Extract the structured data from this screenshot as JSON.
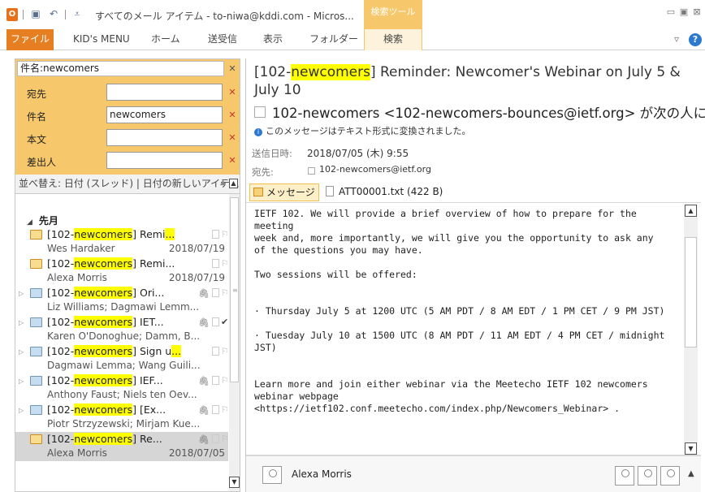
{
  "window": {
    "app_icon_text": "O",
    "title": "すべてのメール アイテム - to-niwa@kddi.com - Micros...",
    "context_tab_header": "検索ツール"
  },
  "ribbon": {
    "tabs": [
      "ファイル",
      "KID's MENU",
      "ホーム",
      "送受信",
      "表示",
      "フォルダー",
      "検索"
    ],
    "accent_color": "#e57f21",
    "context_color": "#f7c86b"
  },
  "search": {
    "main_query": "件名:newcomers",
    "fields": [
      {
        "label": "宛先",
        "value": ""
      },
      {
        "label": "件名",
        "value": "newcomers"
      },
      {
        "label": "本文",
        "value": ""
      },
      {
        "label": "差出人",
        "value": ""
      }
    ]
  },
  "list": {
    "sort_label": "並べ替え: 日付 (スレッド) | 日付の新しいアイテム",
    "group_label": "先月",
    "highlight_term": "newcomers",
    "items": [
      {
        "prefix": "[102-",
        "hl": "newcomers",
        "suffix": "] Remi",
        "tail_hl": "...",
        "from": "Wes Hardaker",
        "date": "2018/07/19",
        "conv": false,
        "attach": false,
        "flag": "flag"
      },
      {
        "prefix": "[102-",
        "hl": "newcomers",
        "suffix": "] Remi...",
        "tail_hl": "",
        "from": "Alexa Morris",
        "date": "2018/07/19",
        "conv": false,
        "attach": false,
        "flag": "flag"
      },
      {
        "prefix": "[102-",
        "hl": "newcomers",
        "suffix": "] Ori...",
        "tail_hl": "",
        "from": "Liz Williams;  Dagmawi Lemm...",
        "date": "",
        "conv": true,
        "attach": true,
        "flag": "flag"
      },
      {
        "prefix": "[102-",
        "hl": "newcomers",
        "suffix": "] IET...",
        "tail_hl": "",
        "from": "Karen O'Donoghue;  Damm, B...",
        "date": "",
        "conv": true,
        "attach": true,
        "flag": "check"
      },
      {
        "prefix": "[102-",
        "hl": "newcomers",
        "suffix": "] Sign u",
        "tail_hl": "...",
        "from": "Dagmawi Lemma;  Wang Guili...",
        "date": "",
        "conv": true,
        "attach": false,
        "flag": "flag"
      },
      {
        "prefix": "[102-",
        "hl": "newcomers",
        "suffix": "] IEF...",
        "tail_hl": "",
        "from": "Anthony Faust;  Niels ten Oev...",
        "date": "",
        "conv": true,
        "attach": true,
        "flag": "flag"
      },
      {
        "prefix": "[102-",
        "hl": "newcomers",
        "suffix": "] [Ex...",
        "tail_hl": "",
        "from": "Piotr Strzyzewski;  Mirjam Kue...",
        "date": "",
        "conv": true,
        "attach": true,
        "flag": "flag"
      },
      {
        "prefix": "[102-",
        "hl": "newcomers",
        "suffix": "] Re...",
        "tail_hl": "",
        "from": "Alexa Morris",
        "date": "2018/07/05",
        "conv": false,
        "attach": true,
        "flag": "flag",
        "selected": true
      }
    ]
  },
  "message": {
    "subject_prefix": "[102-",
    "subject_hl": "newcomers",
    "subject_suffix": "] Reminder: Newcomer's Webinar on July 5 & July 10",
    "sender": "102-newcomers <102-newcomers-bounces@ietf.org> が次の人に",
    "info": "このメッセージはテキスト形式に変換されました。",
    "sent_label": "送信日時:",
    "sent_value": "2018/07/05 (木) 9:55",
    "to_label": "宛先:",
    "to_value": "102-newcomers@ietf.org",
    "tab_message": "メッセージ",
    "tab_attachment": "ATT00001.txt (422 B)",
    "body_lines": [
      "IETF 102. We will provide a brief overview of how to prepare for the meeting",
      "week and, more importantly, we will give you the opportunity to ask any",
      "of the questions you may have.",
      "",
      "Two sessions will be offered:",
      "",
      "",
      "· Thursday July 5 at 1200 UTC (5 AM PDT / 8 AM EDT / 1 PM CET / 9 PM JST)",
      "",
      "· Tuesday July 10 at 1500 UTC (8 AM PDT / 11 AM EDT / 4 PM CET / midnight",
      "JST)",
      "",
      "",
      "Learn more and join either webinar via the Meetecho IETF 102 newcomers",
      "webinar webpage",
      "<https://ietf102.conf.meetecho.com/index.php/Newcomers_Webinar> ."
    ],
    "people_name": "Alexa Morris"
  }
}
